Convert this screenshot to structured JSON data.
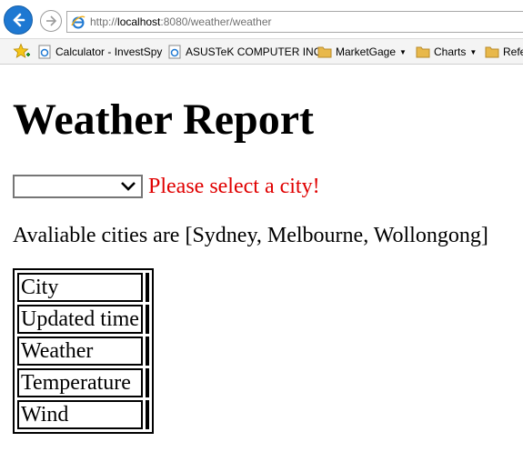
{
  "browser": {
    "url_prefix": "http://",
    "url_host": "localhost",
    "url_rest": ":8080/weather/weather"
  },
  "favorites": [
    {
      "label": "Calculator - InvestSpy",
      "icon": "ie-page-icon"
    },
    {
      "label": "ASUSTeK COMPUTER INC",
      "icon": "ie-page-icon"
    },
    {
      "label": "MarketGage",
      "icon": "folder-icon",
      "dropdown": true
    },
    {
      "label": "Charts",
      "icon": "folder-icon",
      "dropdown": true
    },
    {
      "label": "Refe",
      "icon": "folder-icon"
    }
  ],
  "page": {
    "title": "Weather Report",
    "select_value": "",
    "error": "Please select a city!",
    "available": "Avaliable cities are [Sydney, Melbourne, Wollongong]"
  },
  "table": {
    "rows": [
      {
        "label": "City",
        "value": ""
      },
      {
        "label": "Updated time",
        "value": ""
      },
      {
        "label": "Weather",
        "value": ""
      },
      {
        "label": "Temperature",
        "value": ""
      },
      {
        "label": "Wind",
        "value": ""
      }
    ]
  },
  "colors": {
    "accent_blue": "#1e78d2",
    "error_red": "#e00000"
  }
}
